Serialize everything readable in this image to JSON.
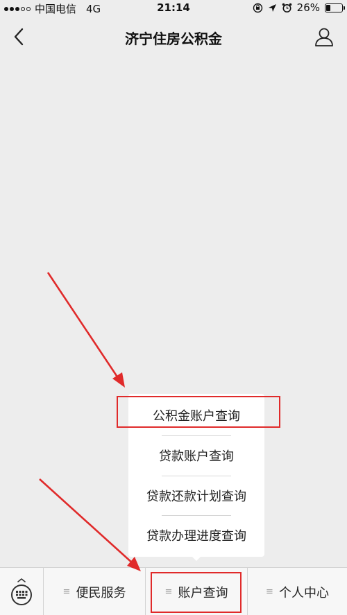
{
  "status_bar": {
    "carrier": "中国电信",
    "network": "4G",
    "time": "21:14",
    "battery": "26%",
    "battery_level": 0.26
  },
  "nav": {
    "title": "济宁住房公积金"
  },
  "popup_menu": {
    "items": [
      {
        "label": "公积金账户查询"
      },
      {
        "label": "贷款账户查询"
      },
      {
        "label": "贷款还款计划查询"
      },
      {
        "label": "贷款办理进度查询"
      }
    ]
  },
  "bottom_menu": {
    "tabs": [
      {
        "label": "便民服务"
      },
      {
        "label": "账户查询"
      },
      {
        "label": "个人中心"
      }
    ]
  },
  "colors": {
    "annotation": "#e02a2a",
    "background": "#ededed"
  },
  "icons": {
    "back": "chevron-left-icon",
    "profile": "person-icon",
    "keyboard": "keyboard-icon",
    "menu_lines": "menu-lines-icon"
  }
}
